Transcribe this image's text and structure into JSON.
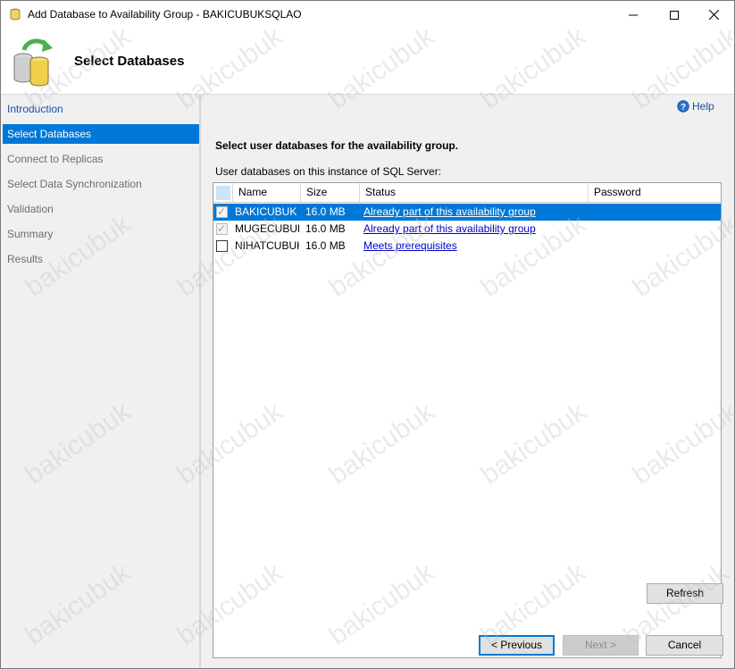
{
  "window": {
    "title": "Add Database to Availability Group - BAKICUBUKSQLAO",
    "controls": {
      "minimize_icon": "minimize-icon",
      "maximize_icon": "maximize-icon",
      "close_icon": "close-icon"
    }
  },
  "header": {
    "title": "Select Databases",
    "icon": "database-sync-icon"
  },
  "sidebar": {
    "items": [
      {
        "label": "Introduction",
        "state": "link"
      },
      {
        "label": "Select Databases",
        "state": "active"
      },
      {
        "label": "Connect to Replicas",
        "state": "inactive"
      },
      {
        "label": "Select Data Synchronization",
        "state": "inactive"
      },
      {
        "label": "Validation",
        "state": "inactive"
      },
      {
        "label": "Summary",
        "state": "inactive"
      },
      {
        "label": "Results",
        "state": "inactive"
      }
    ]
  },
  "main": {
    "help_label": "Help",
    "instruction": "Select user databases for the availability group.",
    "grid_caption": "User databases on this instance of SQL Server:",
    "columns": [
      "Name",
      "Size",
      "Status",
      "Password"
    ],
    "rows": [
      {
        "name": "BAKICUBUK",
        "size": "16.0 MB",
        "status": "Already part of this availability group",
        "checked": true,
        "enabled": false,
        "selected": true
      },
      {
        "name": "MUGECUBUK",
        "size": "16.0 MB",
        "status": "Already part of this availability group",
        "checked": true,
        "enabled": false,
        "selected": false
      },
      {
        "name": "NIHATCUBUK",
        "size": "16.0 MB",
        "status": "Meets prerequisites",
        "checked": false,
        "enabled": true,
        "selected": false
      }
    ],
    "refresh_label": "Refresh"
  },
  "footer": {
    "previous_label": "< Previous",
    "next_label": "Next >",
    "cancel_label": "Cancel"
  },
  "watermark": "bakicubuk",
  "colors": {
    "accent": "#0078d7",
    "link": "#1c4fa6",
    "hyperlink": "#0000cc"
  }
}
